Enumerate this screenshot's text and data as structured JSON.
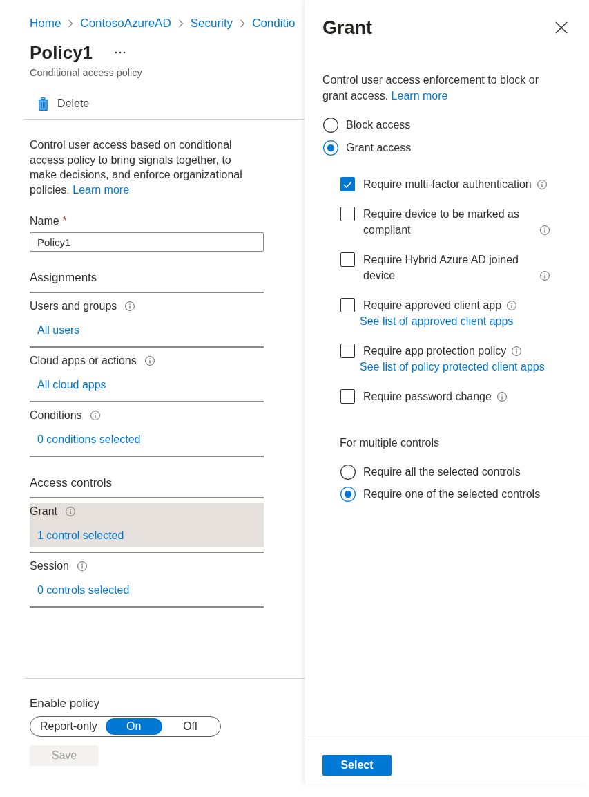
{
  "breadcrumb": [
    {
      "label": "Home"
    },
    {
      "label": "ContosoAzureAD"
    },
    {
      "label": "Security"
    },
    {
      "label": "Conditio"
    }
  ],
  "page": {
    "title": "Policy1",
    "subtitle": "Conditional access policy"
  },
  "toolbar": {
    "delete_label": "Delete"
  },
  "description": {
    "text": "Control user access based on conditional access policy to bring signals together, to make decisions, and enforce organizational policies.",
    "link": "Learn more"
  },
  "name_field": {
    "label": "Name",
    "required_mark": "*",
    "value": "Policy1"
  },
  "assignments": {
    "title": "Assignments",
    "sections": [
      {
        "label": "Users and groups",
        "value": "All users",
        "selected": false
      },
      {
        "label": "Cloud apps or actions",
        "value": "All cloud apps",
        "selected": false
      },
      {
        "label": "Conditions",
        "value": "0 conditions selected",
        "selected": false
      }
    ]
  },
  "access_controls": {
    "title": "Access controls",
    "sections": [
      {
        "label": "Grant",
        "value": "1 control selected",
        "selected": true
      },
      {
        "label": "Session",
        "value": "0 controls selected",
        "selected": false
      }
    ]
  },
  "enable_policy": {
    "label": "Enable policy",
    "options": [
      {
        "label": "Report-only",
        "selected": false
      },
      {
        "label": "On",
        "selected": true
      },
      {
        "label": "Off",
        "selected": false
      }
    ]
  },
  "save_button": {
    "label": "Save",
    "disabled": true
  },
  "grant_panel": {
    "title": "Grant",
    "description": "Control user access enforcement to block or grant access.",
    "description_link": "Learn more",
    "access_options": [
      {
        "label": "Block access",
        "selected": false
      },
      {
        "label": "Grant access",
        "selected": true
      }
    ],
    "controls": [
      {
        "label": "Require multi-factor authentication",
        "checked": true
      },
      {
        "label": "Require device to be marked as compliant",
        "checked": false
      },
      {
        "label": "Require Hybrid Azure AD joined device",
        "checked": false
      },
      {
        "label": "Require approved client app",
        "checked": false,
        "link": "See list of approved client apps"
      },
      {
        "label": "Require app protection policy",
        "checked": false,
        "link": "See list of policy protected client apps"
      },
      {
        "label": "Require password change",
        "checked": false
      }
    ],
    "multiple_controls": {
      "label": "For multiple controls",
      "options": [
        {
          "label": "Require all the selected controls",
          "selected": false
        },
        {
          "label": "Require one of the selected controls",
          "selected": true
        }
      ]
    },
    "select_button": "Select"
  }
}
